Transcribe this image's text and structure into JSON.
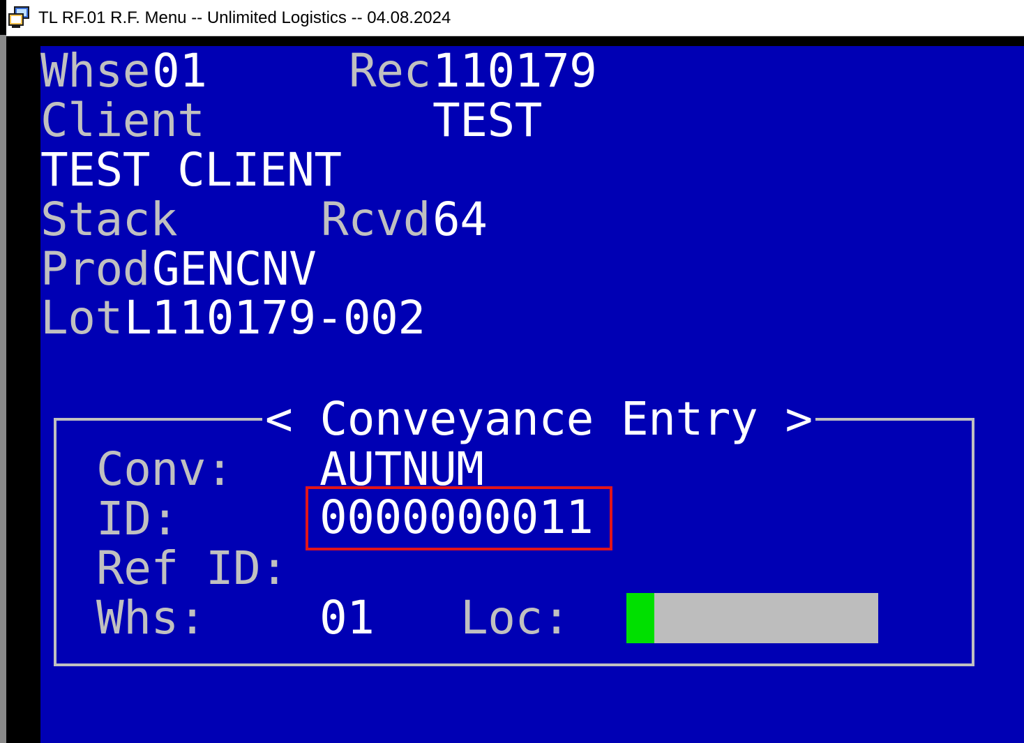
{
  "window": {
    "title": "TL RF.01 R.F. Menu -- Unlimited Logistics -- 04.08.2024",
    "icon": "terminal-app-icon"
  },
  "header": {
    "whse_label": "Whse",
    "whse_value": "01",
    "rec_label": "Rec",
    "rec_value": "110179",
    "client_label": "Client",
    "client_value": "TEST",
    "client_name": "TEST CLIENT",
    "stack_label": "Stack",
    "rcvd_label": "Rcvd",
    "rcvd_value": "64",
    "prod_label": "Prod",
    "prod_value": "GENCNV",
    "lot_label": "Lot",
    "lot_value": "L110179-002"
  },
  "dialog": {
    "title": "< Conveyance Entry >",
    "conv_label": "Conv:",
    "conv_value": "AUTNUM",
    "id_label": "ID:",
    "id_value": "0000000011",
    "ref_id_label": "Ref ID:",
    "whs_label": "Whs:",
    "whs_value": "01",
    "loc_label": "Loc:",
    "loc_value": ""
  },
  "colors": {
    "terminal_bg": "#0000b4",
    "label": "#c0c0c0",
    "value": "#ffffff",
    "highlight_border": "#e0151b",
    "input_field": "#bdbdbd",
    "cursor": "#00e000"
  }
}
